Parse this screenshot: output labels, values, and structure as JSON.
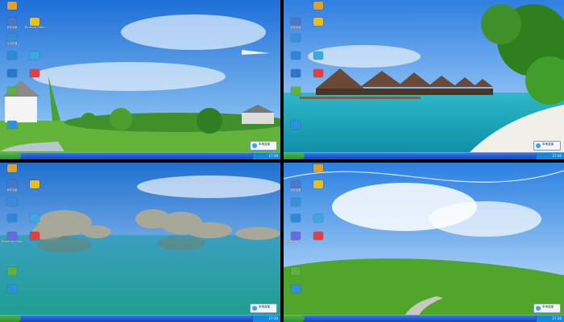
{
  "screens": [
    {
      "id": "screen-1",
      "taskbar": {
        "start_label": "",
        "time": "17:30"
      },
      "tray_popup": {
        "text": "本地连接"
      },
      "icons": [
        {
          "label": "",
          "color": "#e0a030",
          "icon": "qq-icon"
        },
        {
          "label": "我的电脑",
          "color": "#4a78c8",
          "icon": "computer-icon"
        },
        {
          "label": "Microsoft Office",
          "color": "#e8c020",
          "icon": "folder-icon"
        },
        {
          "label": "IE浏览器",
          "color": "#3a8ed8",
          "icon": "ie-icon"
        },
        {
          "label": "",
          "color": "#2e88d8",
          "icon": "network-icon"
        },
        {
          "label": "",
          "color": "#3aa8e0",
          "icon": "media-icon"
        },
        {
          "label": "",
          "color": "#2878c8",
          "icon": "browser-icon"
        },
        {
          "label": "",
          "color": "#e04040",
          "icon": "app-icon"
        },
        {
          "label": "",
          "color": "#60b040",
          "icon": "recycle-icon"
        },
        {
          "label": "",
          "color": "#3090e0",
          "icon": "tool-icon"
        }
      ]
    },
    {
      "id": "screen-2",
      "taskbar": {
        "start_label": "",
        "time": "17:30"
      },
      "tray_popup": {
        "text": "本地连接"
      },
      "icons": [
        {
          "label": "",
          "color": "#e0a030",
          "icon": "qq-icon"
        },
        {
          "label": "我的电脑",
          "color": "#4a78c8",
          "icon": "computer-icon"
        },
        {
          "label": "",
          "color": "#e8c020",
          "icon": "folder-icon"
        },
        {
          "label": "",
          "color": "#3a8ed8",
          "icon": "ie-icon"
        },
        {
          "label": "",
          "color": "#2e88d8",
          "icon": "network-icon"
        },
        {
          "label": "",
          "color": "#3aa8e0",
          "icon": "media-icon"
        },
        {
          "label": "",
          "color": "#2878c8",
          "icon": "browser-icon"
        },
        {
          "label": "",
          "color": "#e04040",
          "icon": "app-icon"
        },
        {
          "label": "",
          "color": "#60b040",
          "icon": "recycle-icon"
        },
        {
          "label": "",
          "color": "#3090e0",
          "icon": "tool-icon"
        }
      ]
    },
    {
      "id": "screen-3",
      "taskbar": {
        "start_label": "",
        "time": "17:30"
      },
      "tray_popup": {
        "text": "本地连接"
      },
      "icons": [
        {
          "label": "",
          "color": "#e0a030",
          "icon": "qq-icon"
        },
        {
          "label": "我的电脑",
          "color": "#4a78c8",
          "icon": "computer-icon"
        },
        {
          "label": "",
          "color": "#e8c020",
          "icon": "folder-icon"
        },
        {
          "label": "",
          "color": "#3a8ed8",
          "icon": "ie-icon"
        },
        {
          "label": "",
          "color": "#2e88d8",
          "icon": "network-icon"
        },
        {
          "label": "",
          "color": "#3aa8e0",
          "icon": "media-icon"
        },
        {
          "label": "Broadcom Diagnostics",
          "color": "#6a6ae0",
          "icon": "app-icon"
        },
        {
          "label": "",
          "color": "#e04040",
          "icon": "app-icon"
        },
        {
          "label": "",
          "color": "#60b040",
          "icon": "recycle-icon"
        },
        {
          "label": "",
          "color": "#3090e0",
          "icon": "tool-icon"
        }
      ]
    },
    {
      "id": "screen-4",
      "taskbar": {
        "start_label": "",
        "time": "17:30"
      },
      "tray_popup": {
        "text": "本地连接"
      },
      "icons": [
        {
          "label": "",
          "color": "#e0a030",
          "icon": "qq-icon"
        },
        {
          "label": "我的电脑",
          "color": "#4a78c8",
          "icon": "computer-icon"
        },
        {
          "label": "",
          "color": "#e8c020",
          "icon": "folder-icon"
        },
        {
          "label": "",
          "color": "#3a8ed8",
          "icon": "ie-icon"
        },
        {
          "label": "",
          "color": "#2e88d8",
          "icon": "network-icon"
        },
        {
          "label": "",
          "color": "#3aa8e0",
          "icon": "media-icon"
        },
        {
          "label": "Broadcom Diagnostics",
          "color": "#6a6ae0",
          "icon": "app-icon"
        },
        {
          "label": "",
          "color": "#e04040",
          "icon": "app-icon"
        },
        {
          "label": "",
          "color": "#60b040",
          "icon": "recycle-icon"
        },
        {
          "label": "",
          "color": "#3090e0",
          "icon": "tool-icon"
        }
      ]
    }
  ]
}
